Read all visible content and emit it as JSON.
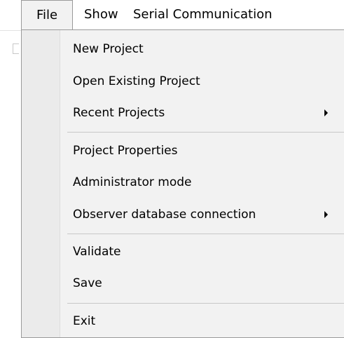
{
  "menubar": {
    "file": "File",
    "show": "Show",
    "serial": "Serial Communication"
  },
  "file_menu": {
    "new_project": "New Project",
    "open_existing_project": "Open Existing Project",
    "recent_projects": "Recent Projects",
    "project_properties": "Project Properties",
    "administrator_mode": "Administrator mode",
    "observer_db_connection": "Observer database connection",
    "validate": "Validate",
    "save": "Save",
    "exit": "Exit"
  }
}
